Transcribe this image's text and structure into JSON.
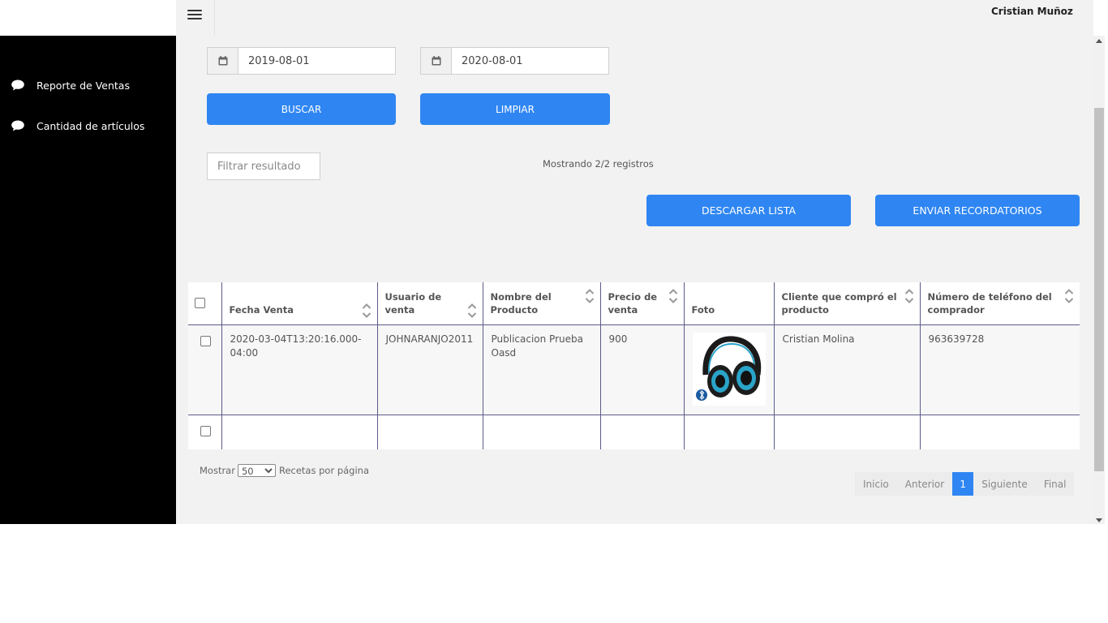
{
  "header": {
    "user_name": "Cristian Muñoz"
  },
  "sidebar": {
    "items": [
      {
        "label": "Reporte de Ventas",
        "icon": "chat-bubble-icon"
      },
      {
        "label": "Cantidad de artículos",
        "icon": "chat-bubble-icon"
      }
    ]
  },
  "filters": {
    "date_from": "2019-08-01",
    "date_to": "2020-08-01",
    "search_label": "BUSCAR",
    "clear_label": "LIMPIAR",
    "filter_placeholder": "Filtrar resultado",
    "showing_text": "Mostrando 2/2 registros",
    "download_label": "DESCARGAR LISTA",
    "reminders_label": "ENVIAR RECORDATORIOS"
  },
  "table": {
    "columns": [
      "Fecha Venta",
      "Usuario de venta",
      "Nombre del Producto",
      "Precio de venta",
      "Foto",
      "Cliente que compró el producto",
      "Número de teléfono del comprador"
    ],
    "rows": [
      {
        "fecha": "2020-03-04T13:20:16.000-04:00",
        "usuario": "JOHNARANJO2011",
        "producto": "Publicacion Prueba Oasd",
        "precio": "900",
        "foto": "headphones-image",
        "cliente": "Cristian Molina",
        "telefono": "963639728"
      }
    ]
  },
  "pagination": {
    "show_label": "Mostrar",
    "per_page_value": "50",
    "per_page_suffix": "Recetas por página",
    "first": "Inicio",
    "prev": "Anterior",
    "current": "1",
    "next": "Siguiente",
    "last": "Final"
  },
  "colors": {
    "primary": "#2f86f2",
    "sidebar_bg": "#000000",
    "content_bg": "#f2f2f2"
  }
}
